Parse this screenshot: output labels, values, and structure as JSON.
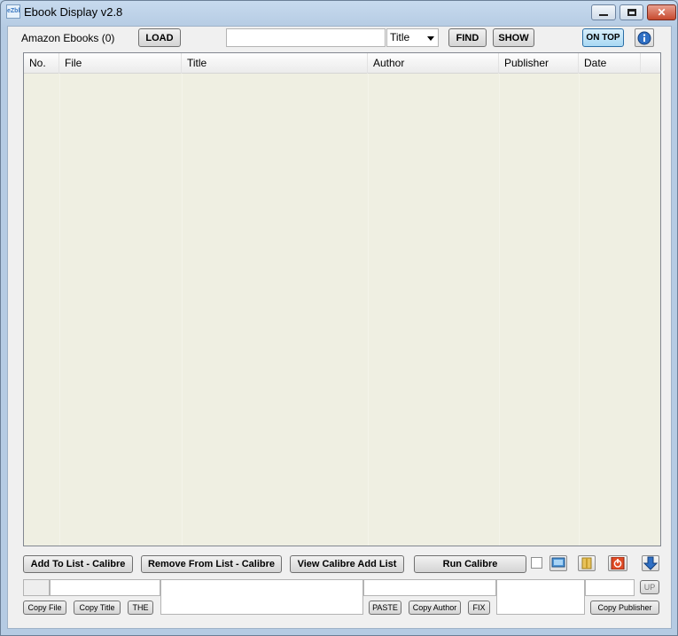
{
  "window": {
    "title": "Ebook Display v2.8",
    "app_icon_text": "eZbl"
  },
  "toolbar": {
    "status_label": "Amazon Ebooks (0)",
    "load_label": "LOAD",
    "search_value": "",
    "field_select_value": "Title",
    "find_label": "FIND",
    "show_label": "SHOW",
    "ontop_label": "ON TOP"
  },
  "table": {
    "columns": [
      "No.",
      "File",
      "Title",
      "Author",
      "Publisher",
      "Date"
    ],
    "rows": []
  },
  "actions": {
    "add_label": "Add To List - Calibre",
    "remove_label": "Remove From List - Calibre",
    "view_label": "View Calibre Add List",
    "run_label": "Run Calibre"
  },
  "bottom": {
    "copy_file_label": "Copy File",
    "copy_title_label": "Copy Title",
    "the_label": "THE",
    "paste_label": "PASTE",
    "copy_author_label": "Copy Author",
    "fix_label": "FIX",
    "copy_publisher_label": "Copy Publisher",
    "up_label": "UP"
  },
  "colors": {
    "list_background": "#efefe2",
    "accent_blue": "#2a6ea6"
  }
}
